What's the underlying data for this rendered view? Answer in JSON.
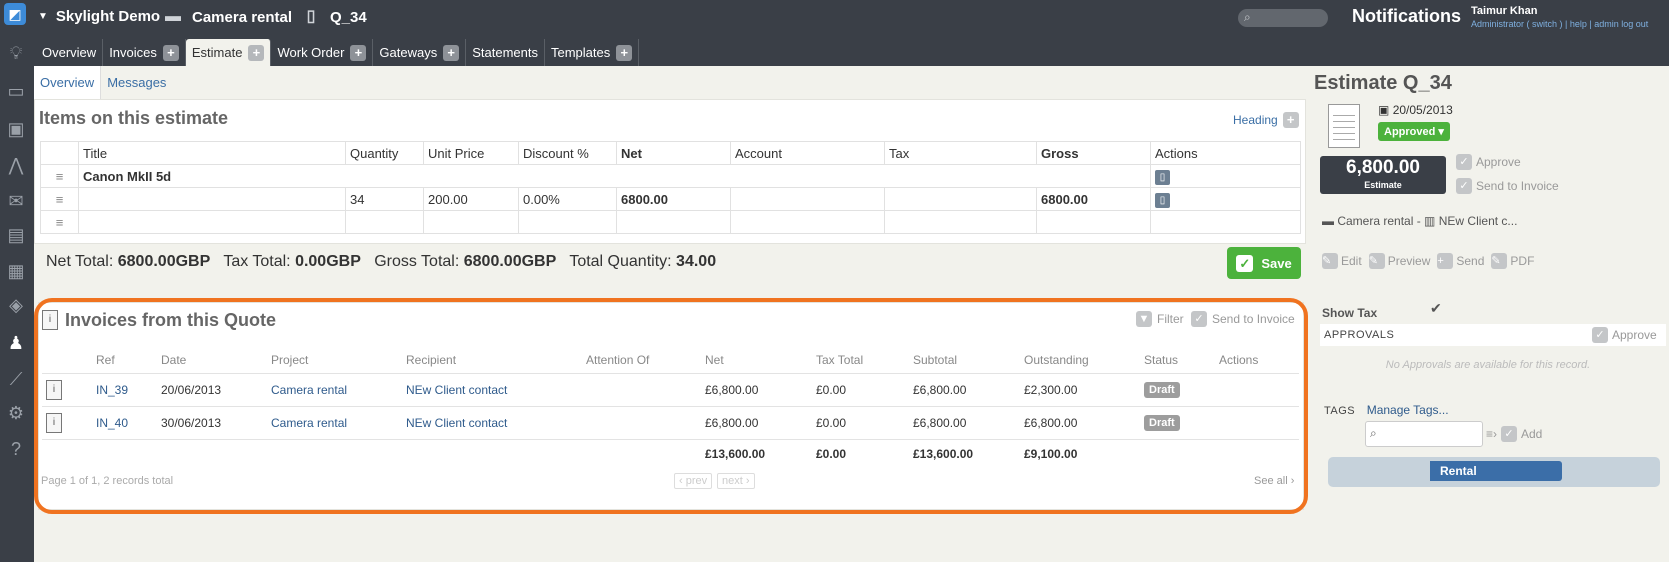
{
  "header": {
    "org": "Skylight Demo",
    "project": "Camera rental",
    "quote": "Q_34",
    "notifications": "Notifications",
    "user_name": "Taimur Khan",
    "user_links": "Administrator ( switch ) | help | admin log out"
  },
  "rail_icons": [
    "app-icon",
    "lightbulb-icon",
    "briefcase-icon",
    "contacts-icon",
    "chart-icon",
    "mail-icon",
    "clipboard-icon",
    "invoice-icon",
    "tag-icon",
    "people-icon",
    "line-chart-icon",
    "settings-icon",
    "help-icon"
  ],
  "tabs": [
    {
      "label": "Overview",
      "plus": false
    },
    {
      "label": "Invoices",
      "plus": true
    },
    {
      "label": "Estimate",
      "plus": true
    },
    {
      "label": "Work Order",
      "plus": true
    },
    {
      "label": "Gateways",
      "plus": true
    },
    {
      "label": "Statements",
      "plus": false
    },
    {
      "label": "Templates",
      "plus": true
    }
  ],
  "active_tab": "Estimate",
  "subtabs": [
    "Overview",
    "Messages"
  ],
  "items": {
    "title": "Items on this estimate",
    "heading_button": "Heading",
    "columns": [
      "Title",
      "Quantity",
      "Unit Price",
      "Discount %",
      "Net",
      "Account",
      "Tax",
      "Gross",
      "Actions"
    ],
    "heading_row": "Canon MkII 5d",
    "row": {
      "quantity": "34",
      "unit_price": "200.00",
      "discount": "0.00%",
      "net": "6800.00",
      "account": "",
      "tax": "",
      "gross": "6800.00"
    }
  },
  "totals": {
    "net_label": "Net Total:",
    "net": "6800.00GBP",
    "tax_label": "Tax Total:",
    "tax": "0.00GBP",
    "gross_label": "Gross Total:",
    "gross": "6800.00GBP",
    "qty_label": "Total Quantity:",
    "qty": "34.00",
    "save": "Save"
  },
  "invoices": {
    "title": "Invoices from this Quote",
    "filter": "Filter",
    "send_to_invoice": "Send to Invoice",
    "columns": [
      "Ref",
      "Date",
      "Project",
      "Recipient",
      "Attention Of",
      "Net",
      "Tax Total",
      "Subtotal",
      "Outstanding",
      "Status",
      "Actions"
    ],
    "rows": [
      {
        "ref": "IN_39",
        "date": "20/06/2013",
        "project": "Camera rental",
        "recipient": "NEw Client contact",
        "attention": "",
        "net": "£6,800.00",
        "tax": "£0.00",
        "subtotal": "£6,800.00",
        "outstanding": "£2,300.00",
        "status": "Draft"
      },
      {
        "ref": "IN_40",
        "date": "30/06/2013",
        "project": "Camera rental",
        "recipient": "NEw Client contact",
        "attention": "",
        "net": "£6,800.00",
        "tax": "£0.00",
        "subtotal": "£6,800.00",
        "outstanding": "£6,800.00",
        "status": "Draft"
      }
    ],
    "totals": {
      "net": "£13,600.00",
      "tax": "£0.00",
      "subtotal": "£13,600.00",
      "outstanding": "£9,100.00"
    },
    "pager": "Page 1 of 1, 2 records total",
    "prev": "‹ prev",
    "next": "next ›",
    "see_all": "See all ›"
  },
  "sidebar": {
    "title": "Estimate Q_34",
    "date": "20/05/2013",
    "status": "Approved ▾",
    "amount": "6,800.00",
    "amount_label": "Estimate",
    "approve": "Approve",
    "send_to_invoice": "Send to Invoice",
    "project_line": "Camera rental - ",
    "client_line": "NEw Client c...",
    "actions": [
      "Edit",
      "Preview",
      "Send",
      "PDF"
    ],
    "show_tax": "Show Tax",
    "approvals_label": "APPROVALS",
    "approvals_approve": "Approve",
    "no_approvals": "No Approvals are available for this record.",
    "tags_label": "TAGS",
    "manage_tags": "Manage Tags...",
    "add": "Add",
    "tag": "Rental"
  },
  "colors": {
    "accent_orange": "#f07320",
    "save_green": "#4cb23c",
    "header_dark": "#3a3f47",
    "link_blue": "#2f5b8c"
  }
}
